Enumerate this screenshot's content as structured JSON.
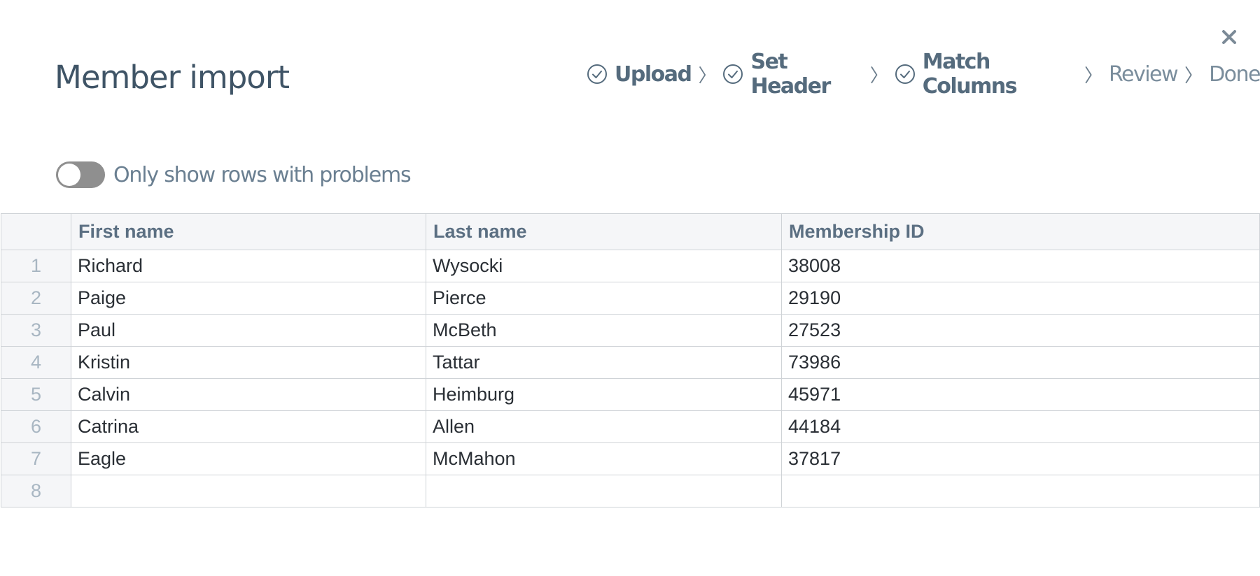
{
  "dialog": {
    "title": "Member import",
    "close_icon": "close-icon"
  },
  "steps": [
    {
      "label": "Upload",
      "status": "done"
    },
    {
      "label": "Set Header",
      "status": "done"
    },
    {
      "label": "Match Columns",
      "status": "done"
    },
    {
      "label": "Review",
      "status": "pending"
    },
    {
      "label": "Done",
      "status": "pending"
    }
  ],
  "filter": {
    "toggle_on": false,
    "label": "Only show rows with problems"
  },
  "table": {
    "columns": [
      "First name",
      "Last name",
      "Membership ID"
    ],
    "rows": [
      {
        "num": "1",
        "cells": [
          "Richard",
          "Wysocki",
          "38008"
        ]
      },
      {
        "num": "2",
        "cells": [
          "Paige",
          "Pierce",
          "29190"
        ]
      },
      {
        "num": "3",
        "cells": [
          "Paul",
          "McBeth",
          "27523"
        ]
      },
      {
        "num": "4",
        "cells": [
          "Kristin",
          "Tattar",
          "73986"
        ]
      },
      {
        "num": "5",
        "cells": [
          "Calvin",
          "Heimburg",
          "45971"
        ]
      },
      {
        "num": "6",
        "cells": [
          "Catrina",
          "Allen",
          "44184"
        ]
      },
      {
        "num": "7",
        "cells": [
          "Eagle",
          "McMahon",
          "37817"
        ]
      },
      {
        "num": "8",
        "cells": [
          "",
          "",
          ""
        ]
      }
    ]
  },
  "colors": {
    "title": "#3f5466",
    "step_done": "#556b7d",
    "step_pending": "#7a8d9c",
    "toggle_off": "#8f8f8f",
    "grid_border": "#cfd3d7",
    "header_bg": "#f5f6f8"
  }
}
